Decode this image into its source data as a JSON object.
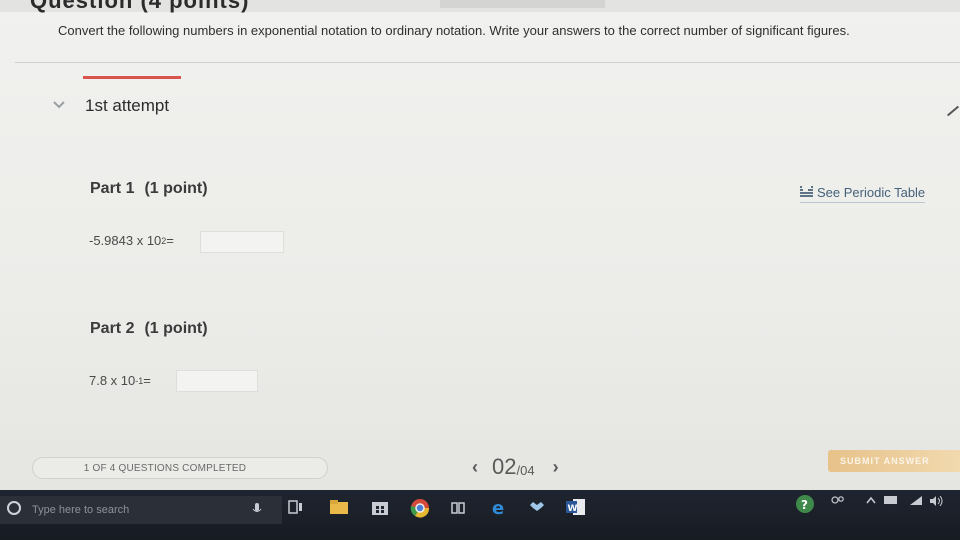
{
  "question": {
    "heading": "Question (4 points)",
    "instruction": "Convert the following numbers in exponential notation to ordinary notation. Write your answers to the correct number of significant figures."
  },
  "attempt": {
    "label": "1st attempt"
  },
  "periodic_table": {
    "label": "See Periodic Table"
  },
  "parts": [
    {
      "title": "Part 1",
      "points": "(1 point)",
      "mantissa": "-5.9843 x 10",
      "exponent": "2",
      "equals": " =",
      "answer_value": ""
    },
    {
      "title": "Part 2",
      "points": "(1 point)",
      "mantissa": "7.8 x 10",
      "exponent": "-1",
      "equals": " =",
      "answer_value": ""
    }
  ],
  "footer": {
    "completed": "1 OF 4 QUESTIONS COMPLETED",
    "current_page": "02",
    "total_pages": "/04",
    "submit_label": "SUBMIT ANSWER"
  },
  "taskbar": {
    "search_placeholder": "Type here to search"
  },
  "colors": {
    "accent_red": "#d9534f",
    "submit_orange": "#e7c28a",
    "link_blue": "#45627a",
    "taskbar": "#1f2530"
  }
}
